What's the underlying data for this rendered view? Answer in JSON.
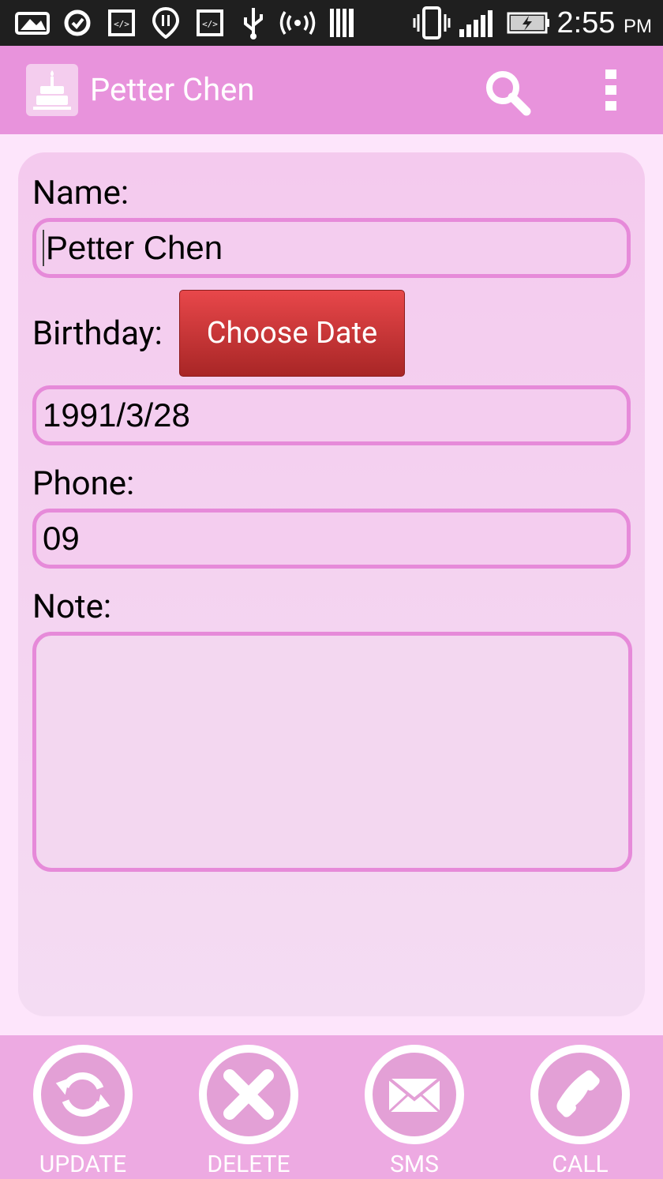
{
  "status_bar": {
    "time": "2:55",
    "ampm": "PM"
  },
  "action_bar": {
    "title": "Petter Chen",
    "logo_icon": "birthday-cake-icon",
    "search_icon": "search-icon",
    "overflow_icon": "overflow-menu-icon"
  },
  "form": {
    "name_label": "Name:",
    "name_value": "Petter Chen",
    "birthday_label": "Birthday:",
    "choose_date_label": "Choose Date",
    "birthday_value": "1991/3/28",
    "phone_label": "Phone:",
    "phone_value": "09",
    "note_label": "Note:",
    "note_value": ""
  },
  "bottom_bar": {
    "buttons": [
      {
        "label": "UPDATE",
        "icon": "refresh-icon"
      },
      {
        "label": "DELETE",
        "icon": "close-icon"
      },
      {
        "label": "SMS",
        "icon": "envelope-icon"
      },
      {
        "label": "CALL",
        "icon": "phone-icon"
      }
    ]
  },
  "colors": {
    "action_bar": "#e893dc",
    "background": "#fde5fb",
    "field_border": "#e68ad9",
    "choose_button": "#c63333",
    "bottom_bar": "#edaae2"
  }
}
